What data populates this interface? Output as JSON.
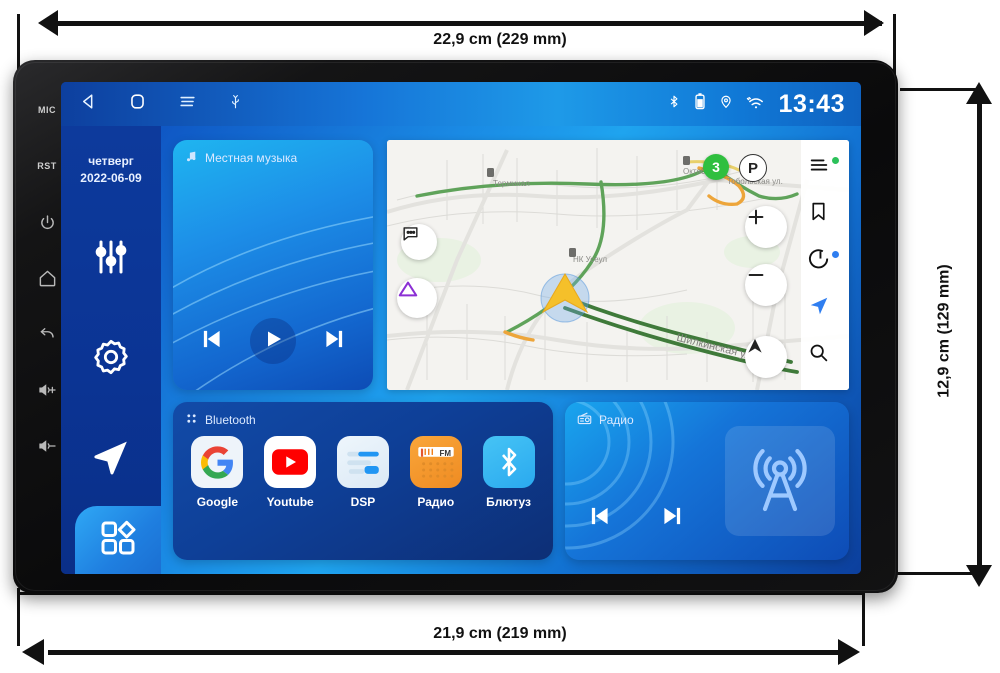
{
  "annotations": {
    "width_top": "22,9 cm (229 mm)",
    "width_bottom": "21,9 cm (219 mm)",
    "height_right": "12,9 cm (129 mm)"
  },
  "device": {
    "bezel_buttons": [
      {
        "name": "mic",
        "label": "MIC",
        "type": "text"
      },
      {
        "name": "reset",
        "label": "RST",
        "type": "text"
      },
      {
        "name": "power",
        "label": "",
        "type": "icon"
      },
      {
        "name": "home",
        "label": "",
        "type": "icon"
      },
      {
        "name": "back",
        "label": "",
        "type": "icon"
      },
      {
        "name": "volume-up",
        "label": "",
        "type": "icon"
      },
      {
        "name": "volume-down",
        "label": "",
        "type": "icon"
      }
    ]
  },
  "statusbar": {
    "nav_icons": [
      "back-icon",
      "home-icon",
      "menu-icon",
      "usb-icon"
    ],
    "status_icons": [
      "bluetooth-icon",
      "battery-icon",
      "location-icon",
      "wifi-icon"
    ],
    "clock": "13:43"
  },
  "rail": {
    "date": {
      "weekday": "четверг",
      "date": "2022-06-09"
    },
    "items": [
      {
        "name": "equalizer",
        "icon": "equalizer-icon"
      },
      {
        "name": "settings",
        "icon": "gear-icon"
      },
      {
        "name": "navigation",
        "icon": "navigation-arrow-icon"
      },
      {
        "name": "apps",
        "icon": "apps-grid-icon",
        "active": true
      }
    ]
  },
  "music_card": {
    "title": "Местная музыка",
    "icon": "music-note-icon",
    "controls": [
      {
        "name": "previous-track",
        "icon": "skip-back-icon"
      },
      {
        "name": "play",
        "icon": "play-icon"
      },
      {
        "name": "next-track",
        "icon": "skip-forward-icon"
      }
    ]
  },
  "map": {
    "traffic_badge": "3",
    "parking_badge": "P",
    "street_labels": [
      "Тобольская ул.",
      "Шилкинская ул.",
      "НК Усеул",
      "Терминал"
    ],
    "left_buttons": [
      {
        "name": "chat",
        "icon": "chat-bubble-icon"
      },
      {
        "name": "report",
        "icon": "triangle-alert-icon"
      }
    ],
    "zoom_buttons": [
      {
        "name": "zoom-in",
        "icon": "plus-icon"
      },
      {
        "name": "zoom-out",
        "icon": "minus-icon"
      },
      {
        "name": "compass",
        "icon": "compass-arrow-icon"
      }
    ],
    "rail_items": [
      {
        "name": "menu",
        "icon": "map-menu-icon",
        "dot": "green"
      },
      {
        "name": "bookmarks",
        "icon": "bookmark-icon",
        "dot": ""
      },
      {
        "name": "yandex-navigator",
        "icon": "yandex-d-icon",
        "dot": "blue"
      },
      {
        "name": "navigate",
        "icon": "navigate-arrow-icon",
        "dot": ""
      },
      {
        "name": "search",
        "icon": "search-icon",
        "dot": ""
      }
    ]
  },
  "app_card": {
    "title": "Bluetooth",
    "icon": "apps-dots-icon",
    "apps": [
      {
        "name": "google",
        "label": "Google",
        "icon": "google-g-icon"
      },
      {
        "name": "youtube",
        "label": "Youtube",
        "icon": "youtube-icon"
      },
      {
        "name": "dsp",
        "label": "DSP",
        "icon": "dsp-sliders-icon"
      },
      {
        "name": "radio",
        "label": "Радио",
        "icon": "fm-radio-icon",
        "badge": "FM"
      },
      {
        "name": "bluetooth",
        "label": "Блютуз",
        "icon": "bluetooth-icon"
      }
    ]
  },
  "radio_card": {
    "title": "Радио",
    "icon": "radio-set-icon",
    "art_icon": "radio-tower-icon",
    "controls": [
      {
        "name": "previous-station",
        "icon": "skip-back-icon"
      },
      {
        "name": "next-station",
        "icon": "skip-forward-icon"
      }
    ]
  },
  "colors": {
    "accent": "#1fa4ef",
    "rail": "#0b3494",
    "card_dark": "#0d2f76",
    "traffic_green": "#2fbf3f",
    "yandex_blue": "#2f7ef0"
  }
}
